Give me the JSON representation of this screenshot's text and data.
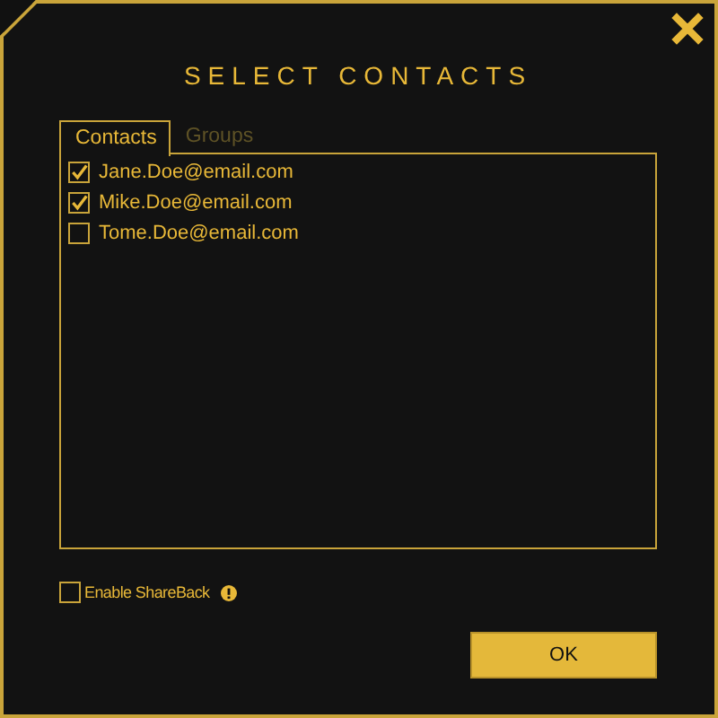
{
  "dialog": {
    "title": "SELECT CONTACTS"
  },
  "tabs": [
    {
      "label": "Contacts",
      "selected": true
    },
    {
      "label": "Groups",
      "selected": false
    }
  ],
  "contacts": [
    {
      "email": "Jane.Doe@email.com",
      "checked": true
    },
    {
      "email": "Mike.Doe@email.com",
      "checked": true
    },
    {
      "email": "Tome.Doe@email.com",
      "checked": false
    }
  ],
  "share_back": {
    "label": "Enable ShareBack",
    "checked": false
  },
  "buttons": [
    "OK"
  ]
}
